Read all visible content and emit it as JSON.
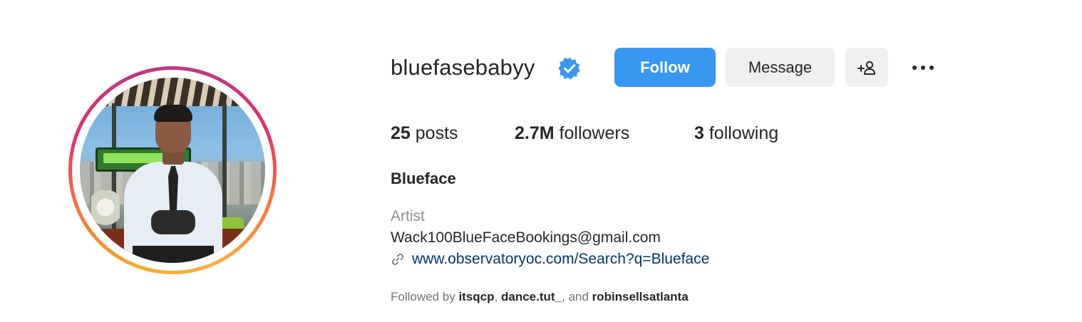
{
  "profile": {
    "username": "bluefasebabyy",
    "full_name": "Blueface",
    "category": "Artist",
    "bio_line": "Wack100BlueFaceBookings@gmail.com",
    "link": "www.observatoryoc.com/Search?q=Blueface"
  },
  "actions": {
    "follow_label": "Follow",
    "message_label": "Message"
  },
  "stats": {
    "posts_count": "25",
    "posts_label": "posts",
    "followers_count": "2.7M",
    "followers_label": "followers",
    "following_count": "3",
    "following_label": "following"
  },
  "followed_by": {
    "prefix": "Followed by",
    "accounts": [
      "itsqcp",
      "dance.tut_",
      "robinsellsatlanta"
    ],
    "sep1": ",",
    "sep2": ", and"
  },
  "icons": {
    "verified": "verified-badge-icon",
    "suggest": "add-person-icon",
    "more": "more-options-icon",
    "link": "link-icon"
  },
  "colors": {
    "follow_button": "#3897f0",
    "verified": "#3897f0",
    "secondary_button": "#efefef",
    "link": "#00376b"
  }
}
